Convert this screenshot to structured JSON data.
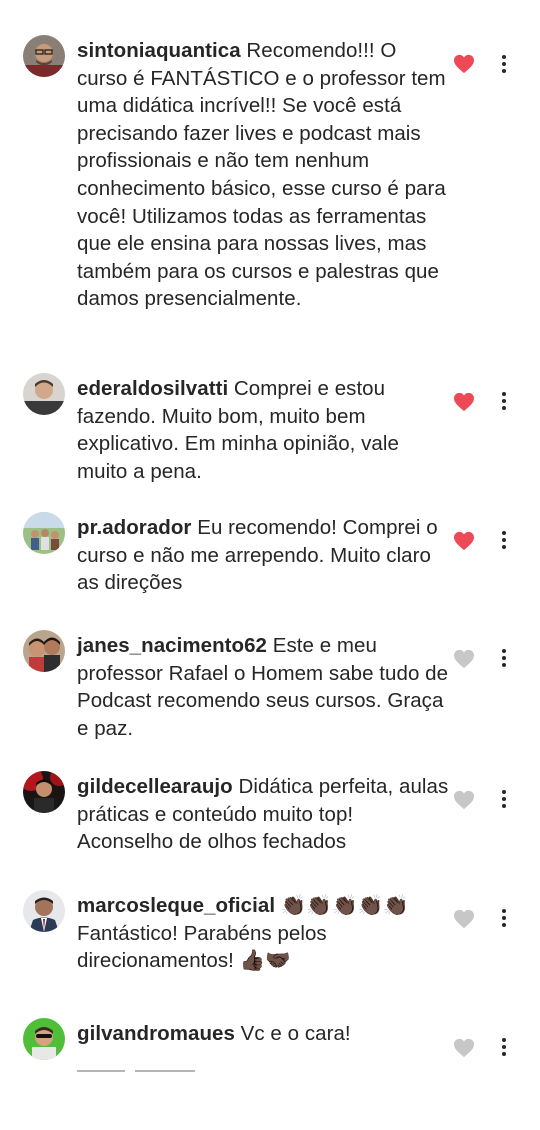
{
  "colors": {
    "liked": "#ed4956",
    "unliked": "#c7c7c7",
    "text": "#262626"
  },
  "comments": [
    {
      "username": "sintoniaquantica",
      "text": " Recomendo!!! O curso é FANTÁSTICO e o professor tem uma didática incrível!! Se você está precisando fazer lives e podcast mais profissionais e não tem nenhum conhecimento básico, esse curso é para você! Utilizamos todas as ferramentas que ele ensina para nossas lives, mas também para os cursos e palestras que damos presencialmente.",
      "liked": true,
      "avatar": "avatar-man-glasses"
    },
    {
      "username": "ederaldosilvatti",
      "text": " Comprei e estou fazendo. Muito bom, muito bem explicativo.  Em minha opinião, vale muito a pena.",
      "liked": true,
      "avatar": "avatar-man"
    },
    {
      "username": "pr.adorador",
      "text": " Eu recomendo! Comprei o curso e não me arrependo. Muito claro as direções",
      "liked": true,
      "avatar": "avatar-group-outdoor"
    },
    {
      "username": "janes_nacimento62",
      "text": " Este e meu professor Rafael o Homem sabe tudo de Podcast recomendo seus cursos. Graça e paz.",
      "liked": false,
      "avatar": "avatar-couple"
    },
    {
      "username": "gildecellearaujo",
      "text": " Didática perfeita, aulas práticas e conteúdo muito top! Aconselho de olhos fechados",
      "liked": false,
      "avatar": "avatar-man-red-light"
    },
    {
      "username": "marcosleque_oficial",
      "text": " 👏🏿👏🏿👏🏿👏🏿👏🏿 Fantástico! Parabéns pelos direcionamentos! 👍🏿🤝🏿",
      "liked": false,
      "avatar": "avatar-man-suit"
    },
    {
      "username": "gilvandromaues",
      "text": " Vc e o cara!",
      "liked": false,
      "avatar": "avatar-man-green-bg"
    }
  ]
}
